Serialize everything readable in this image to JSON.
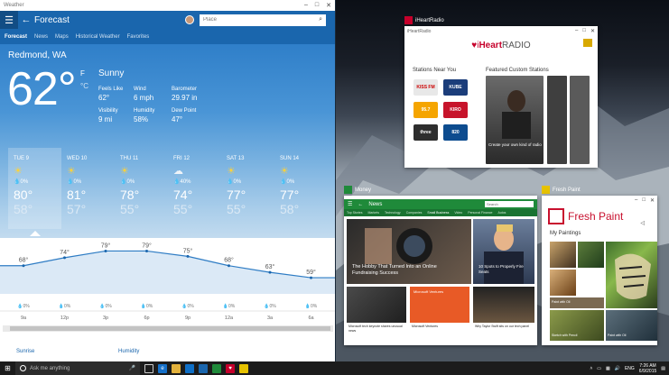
{
  "weather": {
    "window_title": "Weather",
    "app_title": "Forecast",
    "search_placeholder": "Place",
    "tabs": [
      "Forecast",
      "News",
      "Maps",
      "Historical Weather",
      "Favorites"
    ],
    "location": "Redmond, WA",
    "temperature": "62°",
    "unit_f": "F",
    "unit_c": "°C",
    "condition": "Sunny",
    "stats": [
      {
        "label": "Feels Like",
        "value": "62°"
      },
      {
        "label": "Wind",
        "value": "6 mph"
      },
      {
        "label": "Barometer",
        "value": "29.97 in"
      },
      {
        "label": "Visibility",
        "value": "9 mi"
      },
      {
        "label": "Humidity",
        "value": "58%"
      },
      {
        "label": "Dew Point",
        "value": "47°"
      }
    ],
    "days": [
      {
        "name": "TUE 9",
        "icon": "sun-icon",
        "precip": "0%",
        "hi": "80°",
        "lo": "58°"
      },
      {
        "name": "WED 10",
        "icon": "sun-icon",
        "precip": "0%",
        "hi": "81°",
        "lo": "57°"
      },
      {
        "name": "THU 11",
        "icon": "sun-icon",
        "precip": "0%",
        "hi": "78°",
        "lo": "55°"
      },
      {
        "name": "FRI 12",
        "icon": "cloud-icon",
        "precip": "40%",
        "hi": "74°",
        "lo": "55°"
      },
      {
        "name": "SAT 13",
        "icon": "sun-icon",
        "precip": "0%",
        "hi": "77°",
        "lo": "55°"
      },
      {
        "name": "SUN 14",
        "icon": "sun-icon",
        "precip": "0%",
        "hi": "77°",
        "lo": "58°"
      }
    ],
    "hourly": {
      "times": [
        "9a",
        "12p",
        "3p",
        "6p",
        "9p",
        "12a",
        "3a",
        "6a"
      ],
      "temps": [
        "68°",
        "74°",
        "79°",
        "79°",
        "75°",
        "68°",
        "63°",
        "59°"
      ],
      "precip": [
        "0%",
        "0%",
        "0%",
        "0%",
        "0%",
        "0%",
        "0%",
        "0%"
      ],
      "values": [
        68,
        74,
        79,
        79,
        75,
        68,
        63,
        59
      ]
    },
    "bottom": {
      "sunrise": "Sunrise",
      "humidity": "Humidity"
    }
  },
  "iheart": {
    "window_title": "iHeartRadio",
    "chip_label": "iHeartRadio",
    "brand_prefix": "i",
    "brand_heart": "Heart",
    "brand_suffix": "RADIO",
    "stations_title": "Stations Near You",
    "featured_title": "Featured Custom Stations",
    "stations": [
      "KISS FM",
      "KUBE",
      "95.7",
      "KIRO",
      "three",
      "820"
    ],
    "feature_text": "Create your own kind of radio"
  },
  "money": {
    "chip_label": "Money",
    "nav": "News",
    "search": "Search",
    "subnav": [
      "Top Stories",
      "Markets",
      "Technology",
      "Companies",
      "Small Business",
      "Video",
      "Personal Finance",
      "Autos"
    ],
    "story1": "The Hobby That Turned Into an Online Fundraising Success",
    "story2": "10 Spots to Properly Fire Seats",
    "small1": "Microsoft tech keynote shares unusual news",
    "small2": "Microsoft Ventures",
    "small3": "Why Taylor Swift sits on our tech panel",
    "ventures_label": "Microsoft Ventures"
  },
  "fresh": {
    "chip_label": "Fresh Paint",
    "brand": "Fresh Paint",
    "my_paintings": "My Paintings",
    "cap1": "Paint with Oil",
    "cap2": "Sketch with Pencil",
    "cap3": "Paint with Oil"
  },
  "taskbar": {
    "search_text": "Ask me anything",
    "lang": "ENG",
    "time": "7:26 AM",
    "date": "6/9/2015"
  }
}
